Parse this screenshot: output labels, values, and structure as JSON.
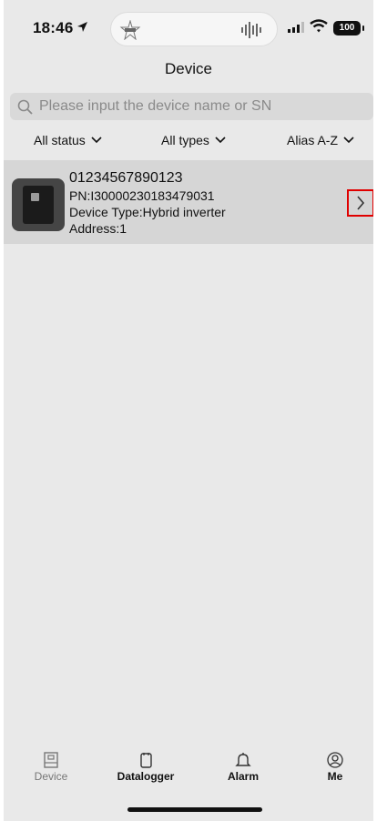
{
  "status_bar": {
    "time": "18:46",
    "battery": "100",
    "icons": [
      "location-arrow-icon",
      "cellular-signal-icon",
      "wifi-icon",
      "battery-icon"
    ]
  },
  "header": {
    "title": "Device"
  },
  "search": {
    "placeholder": "Please input the device name or SN"
  },
  "filters": {
    "status": "All status",
    "types": "All types",
    "sort": "Alias A-Z"
  },
  "devices": [
    {
      "serial": "01234567890123",
      "pn": "PN:I30000230183479031",
      "type": "Device Type:Hybrid inverter",
      "address": "Address:1"
    }
  ],
  "tabs": [
    {
      "label": "Device",
      "icon": "device-icon",
      "active": true
    },
    {
      "label": "Datalogger",
      "icon": "datalogger-icon",
      "active": false
    },
    {
      "label": "Alarm",
      "icon": "bell-icon",
      "active": false
    },
    {
      "label": "Me",
      "icon": "person-icon",
      "active": false
    }
  ],
  "colors": {
    "background": "#e9e9e9",
    "card": "#d6d6d6",
    "highlight": "#e00000"
  }
}
